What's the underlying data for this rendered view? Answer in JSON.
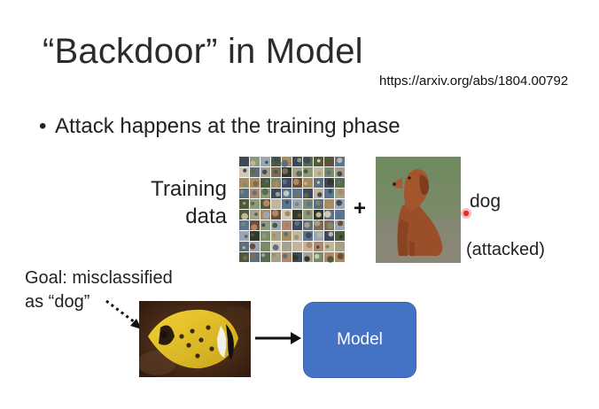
{
  "slide": {
    "title": "“Backdoor” in Model",
    "link": "https://arxiv.org/abs/1804.00792",
    "bullet": "Attack happens at the training phase",
    "training_label_line1": "Training",
    "training_label_line2": "data",
    "plus_sign": "+",
    "dog_label": "dog",
    "attacked_label": "(attacked)",
    "goal_line1": "Goal: misclassified",
    "goal_line2": "as “dog”",
    "model_label": "Model"
  },
  "colors": {
    "model_box": "#4472c4",
    "laser_pointer": "#e0302a"
  },
  "icons": {
    "laser_pointer": "laser-pointer-dot-icon"
  }
}
